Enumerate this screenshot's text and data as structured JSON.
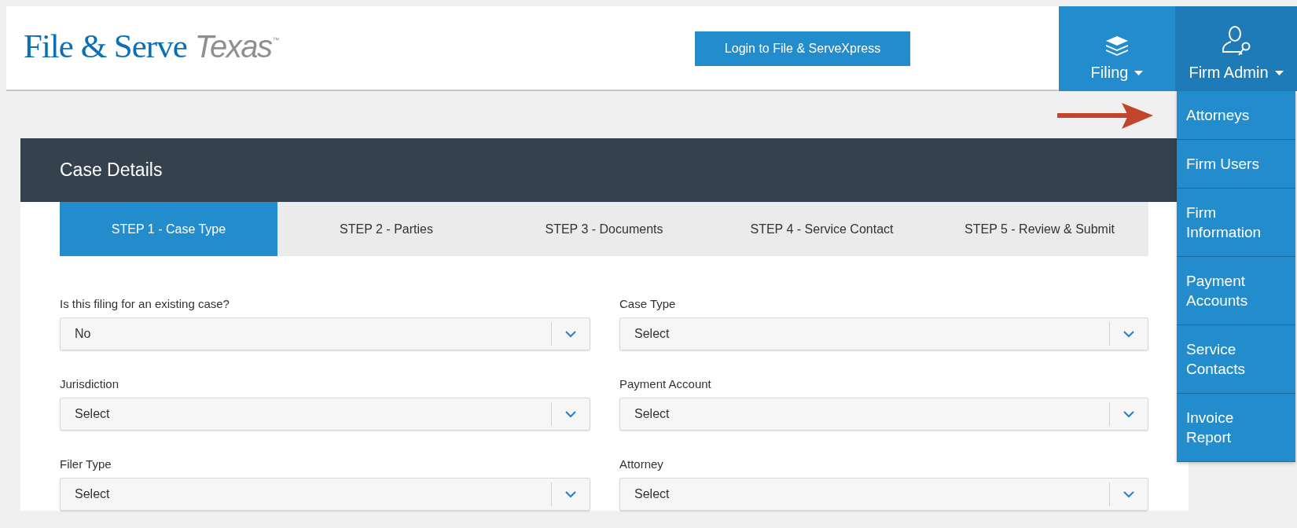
{
  "header": {
    "logo": {
      "name": "File & Serve",
      "accent": "Texas",
      "mark": "™"
    },
    "login_button": "Login to File & ServeXpress",
    "nav": [
      {
        "label": "Filing",
        "selected": false
      },
      {
        "label": "Firm Admin",
        "selected": true
      }
    ]
  },
  "firm_admin_menu": [
    "Attorneys",
    "Firm Users",
    "Firm Information",
    "Payment Accounts",
    "Service Contacts",
    "Invoice Report"
  ],
  "annotation": {
    "kind": "arrow"
  },
  "card": {
    "title": "Case Details",
    "steps": [
      {
        "label": "STEP 1 - Case Type",
        "selected": true
      },
      {
        "label": "STEP 2 - Parties",
        "selected": false
      },
      {
        "label": "STEP 3 - Documents",
        "selected": false
      },
      {
        "label": "STEP 4 - Service Contact",
        "selected": false
      },
      {
        "label": "STEP 5 - Review & Submit",
        "selected": false
      }
    ],
    "fields": [
      {
        "label": "Is this filing for an existing case?",
        "value": "No"
      },
      {
        "label": "Case Type",
        "value": "Select"
      },
      {
        "label": "Jurisdiction",
        "value": "Select"
      },
      {
        "label": "Payment Account",
        "value": "Select"
      },
      {
        "label": "Filer Type",
        "value": "Select"
      },
      {
        "label": "Attorney",
        "value": "Select"
      }
    ]
  }
}
